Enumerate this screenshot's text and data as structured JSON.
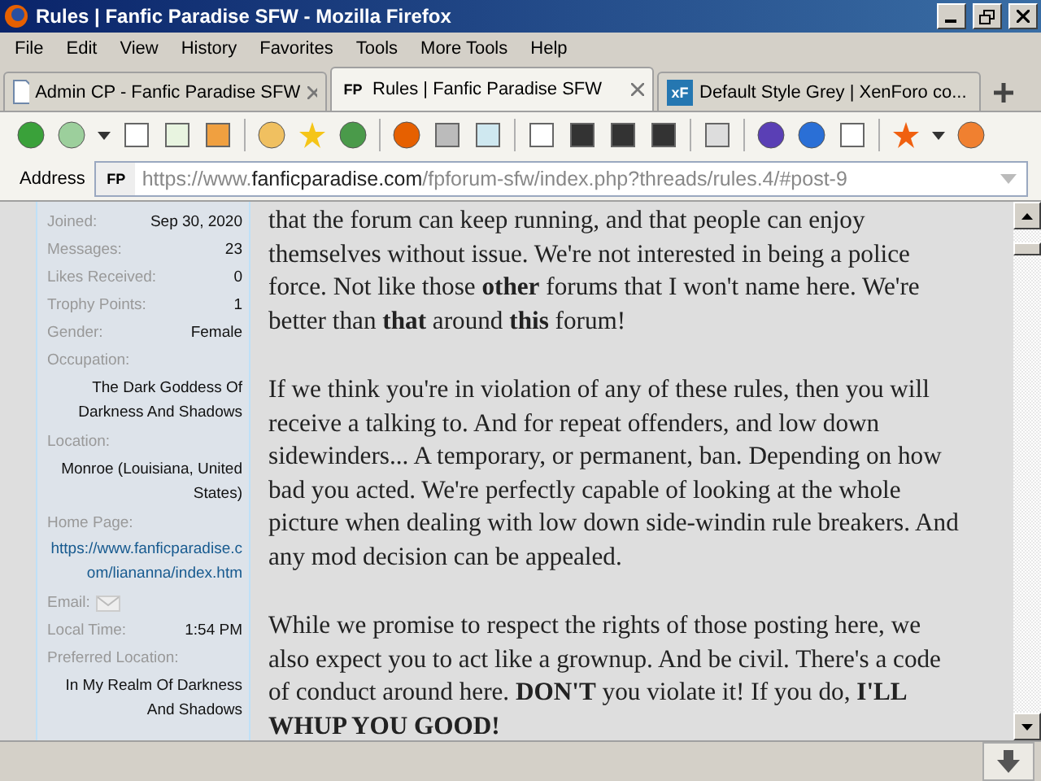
{
  "window": {
    "title": "Rules | Fanfic Paradise SFW - Mozilla Firefox"
  },
  "menu": [
    "File",
    "Edit",
    "View",
    "History",
    "Favorites",
    "Tools",
    "More Tools",
    "Help"
  ],
  "tabs": [
    {
      "label": "Admin CP - Fanfic Paradise SFW",
      "selected": false
    },
    {
      "label": "Rules | Fanfic Paradise SFW",
      "favicon": "FP",
      "selected": true
    },
    {
      "label": "Default Style Grey | XenForo co...",
      "favicon": "xF",
      "selected": false
    }
  ],
  "address": {
    "label": "Address",
    "favicon": "FP",
    "url_prefix": "https://www.",
    "url_domain": "fanficparadise.com",
    "url_path": "/fpforum-sfw/index.php?threads/rules.4/#post-9"
  },
  "profile": [
    {
      "kind": "inline",
      "label": "Joined:",
      "value": "Sep 30, 2020"
    },
    {
      "kind": "inline",
      "label": "Messages:",
      "value": "23"
    },
    {
      "kind": "inline",
      "label": "Likes Received:",
      "value": "0"
    },
    {
      "kind": "inline",
      "label": "Trophy Points:",
      "value": "1"
    },
    {
      "kind": "inline",
      "label": "Gender:",
      "value": "Female"
    },
    {
      "kind": "block",
      "label": "Occupation:",
      "value": "The Dark Goddess Of Darkness And Shadows"
    },
    {
      "kind": "block",
      "label": "Location:",
      "value": "Monroe (Louisiana, United States)"
    },
    {
      "kind": "link",
      "label": "Home Page:",
      "value": "https://www.fanficparadise.com/liananna/index.htm"
    },
    {
      "kind": "email",
      "label": "Email:"
    },
    {
      "kind": "inline",
      "label": "Local Time:",
      "value": "1:54 PM"
    },
    {
      "kind": "block",
      "label": "Preferred Location:",
      "value": "In My Realm Of Darkness And Shadows"
    }
  ],
  "post": [
    "that the forum can keep running, and that people can enjoy themselves without issue. We're not interested in being a police force. Not like those **other** forums that I won't name here. We're better than **that** around **this** forum!",
    "If we think you're in violation of any of these rules, then you will receive a talking to. And for repeat offenders, and low down sidewinders... A temporary, or permanent, ban. Depending on how bad you acted. We're perfectly capable of looking at the whole picture when dealing with low down side-windin rule breakers. And any mod decision can be appealed.",
    "While we promise to respect the rights of those posting here, we also expect you to act like a grownup. And be civil. There's a code of conduct around here. **DON'T** you violate it! If you do, **I'LL WHUP YOU GOOD!**"
  ]
}
